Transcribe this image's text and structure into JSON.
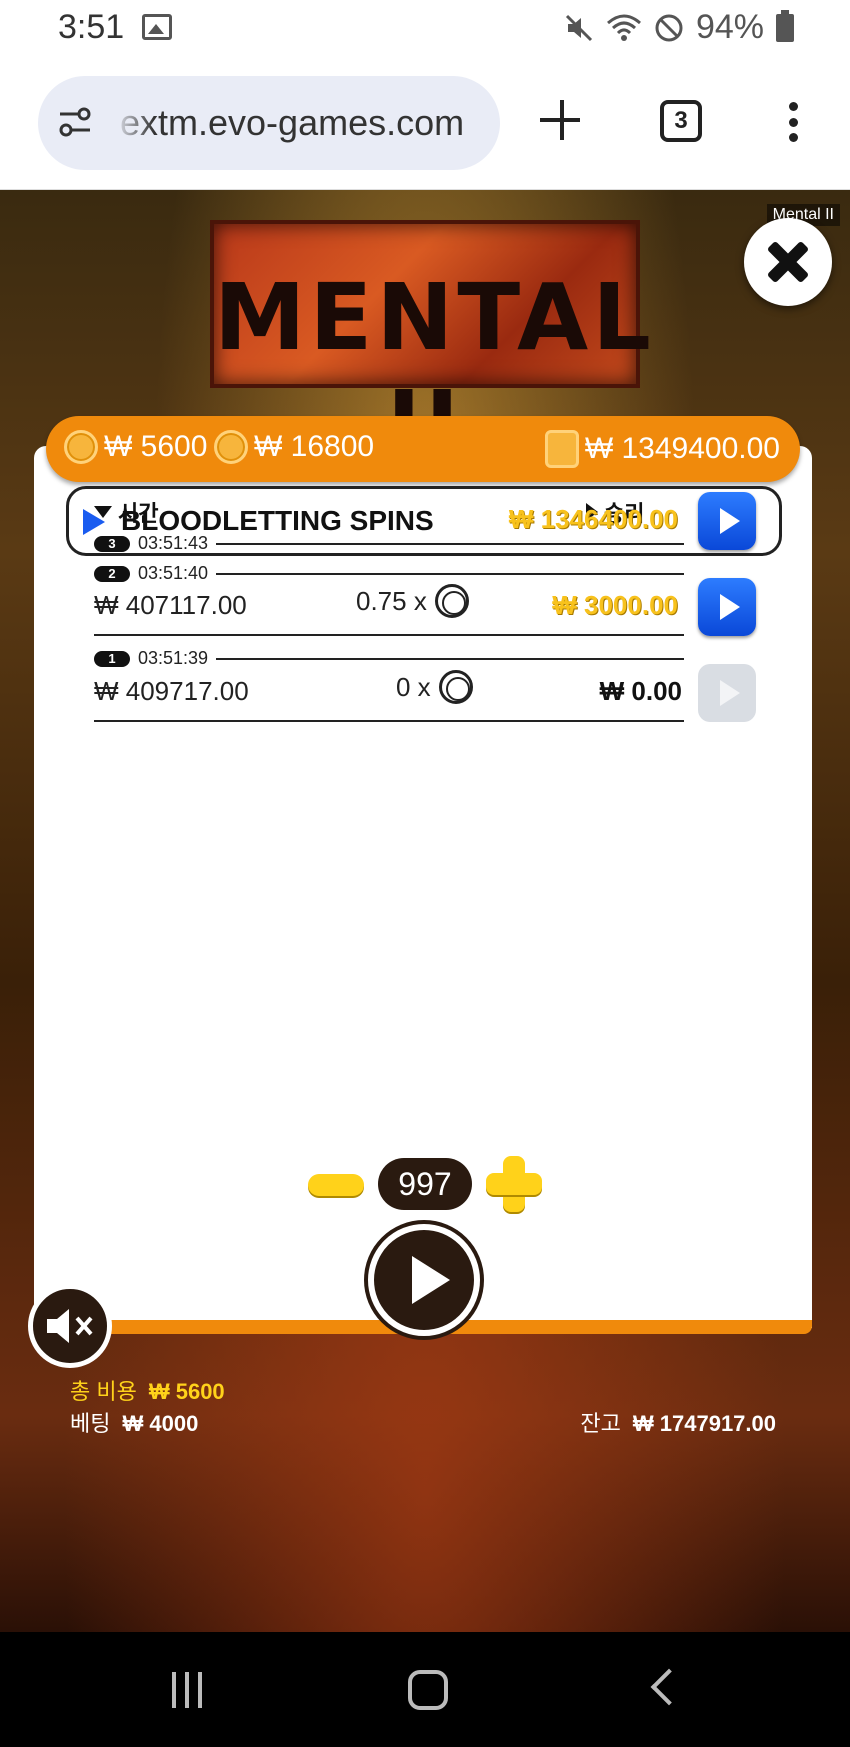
{
  "status_bar": {
    "time": "3:51",
    "battery": "94%"
  },
  "browser": {
    "url": "extm.evo-games.com",
    "tab_count": "3"
  },
  "game": {
    "label": "Mental II",
    "logo_text": "MENTAL II",
    "header": {
      "cost": "₩ 5600",
      "bonus_cost": "₩ 16800",
      "balance": "₩ 1349400.00"
    },
    "columns": {
      "time": "시간",
      "win": "승리"
    },
    "rows": [
      {
        "num": "3",
        "time": "03:51:43",
        "title": "BLOODLETTING SPINS",
        "win": "₩ 1346400.00"
      },
      {
        "num": "2",
        "time": "03:51:40",
        "bet": "₩ 407117.00",
        "multiplier": "0.75 x",
        "win": "₩ 3000.00"
      },
      {
        "num": "1",
        "time": "03:51:39",
        "bet": "₩ 409717.00",
        "multiplier": "0 x",
        "win": "₩ 0.00"
      }
    ],
    "spin_count": "997",
    "footer": {
      "total_cost_label": "총 비용",
      "total_cost": "₩ 5600",
      "bet_label": "베팅",
      "bet": "₩ 4000",
      "balance_label": "잔고",
      "balance": "₩ 1747917.00"
    }
  }
}
